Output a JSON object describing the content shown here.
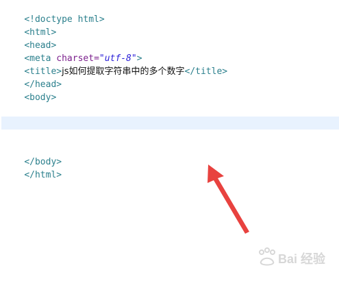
{
  "editor": {
    "lines": {
      "doctype": "<!doctype html>",
      "html_open": "<html>",
      "head_open": "<head>",
      "meta_open": "<meta ",
      "meta_attr": "charset=",
      "meta_value": "\"utf-8\"",
      "meta_close": ">",
      "title_open": "<title>",
      "title_text": "js如何提取字符串中的多个数字",
      "title_close": "</title>",
      "head_close": "</head>",
      "body_open": "<body>",
      "body_close": "</body>",
      "html_close": "</html>"
    }
  },
  "colors": {
    "tag": "#2a7f8c",
    "attr": "#7b1f8c",
    "attr_value": "#2b20d8",
    "current_line": "#e8f2fe",
    "arrow": "#e8423f"
  },
  "watermark": {
    "text": "Bai 经验"
  }
}
